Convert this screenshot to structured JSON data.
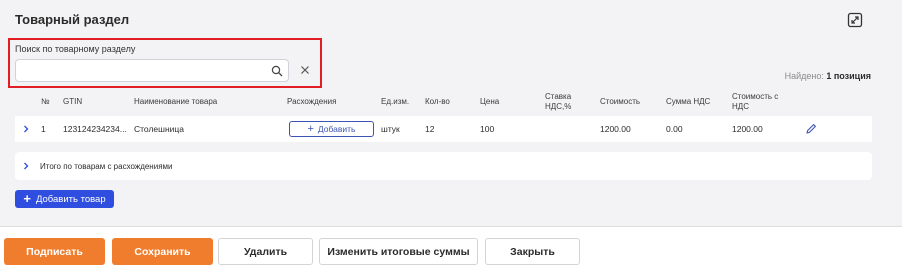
{
  "section": {
    "title": "Товарный раздел"
  },
  "search": {
    "label": "Поиск по товарному разделу",
    "value": "",
    "placeholder": ""
  },
  "found": {
    "prefix": "Найдено: ",
    "count": "1 позиция"
  },
  "table": {
    "headers": {
      "num": "№",
      "gtin": "GTIN",
      "name": "Наименование товара",
      "diff": "Расхождения",
      "unit": "Ед.изм.",
      "qty": "Кол-во",
      "price": "Цена",
      "vat_rate": "Ставка НДС,%",
      "cost": "Стоимость",
      "vat_sum": "Сумма НДС",
      "cost_vat": "Стоимость с НДС"
    },
    "rows": [
      {
        "num": "1",
        "gtin": "123124234234...",
        "name": "Столешница",
        "diff_button": "Добавить",
        "unit": "штук",
        "qty": "12",
        "price": "100",
        "vat_rate": "",
        "cost": "1200.00",
        "vat_sum": "0.00",
        "cost_vat": "1200.00"
      }
    ]
  },
  "discrepancies": {
    "label": "Итого по товарам с расхождениями"
  },
  "add_goods_label": "Добавить товар",
  "footer": {
    "sign": "Подписать",
    "save": "Сохранить",
    "delete": "Удалить",
    "change_totals": "Изменить итоговые суммы",
    "close": "Закрыть"
  },
  "colors": {
    "primary_orange": "#f07d2e",
    "accent_blue": "#2f4ee0",
    "outline_blue": "#3d53b4",
    "highlight_red": "#e01e24",
    "panel_bg": "#f3f3f5"
  },
  "icons": {
    "expand": "expand-icon",
    "search": "search-icon",
    "clear": "close-icon",
    "row_expand": "chevron-right-icon",
    "edit": "pencil-icon",
    "add": "plus-icon"
  }
}
